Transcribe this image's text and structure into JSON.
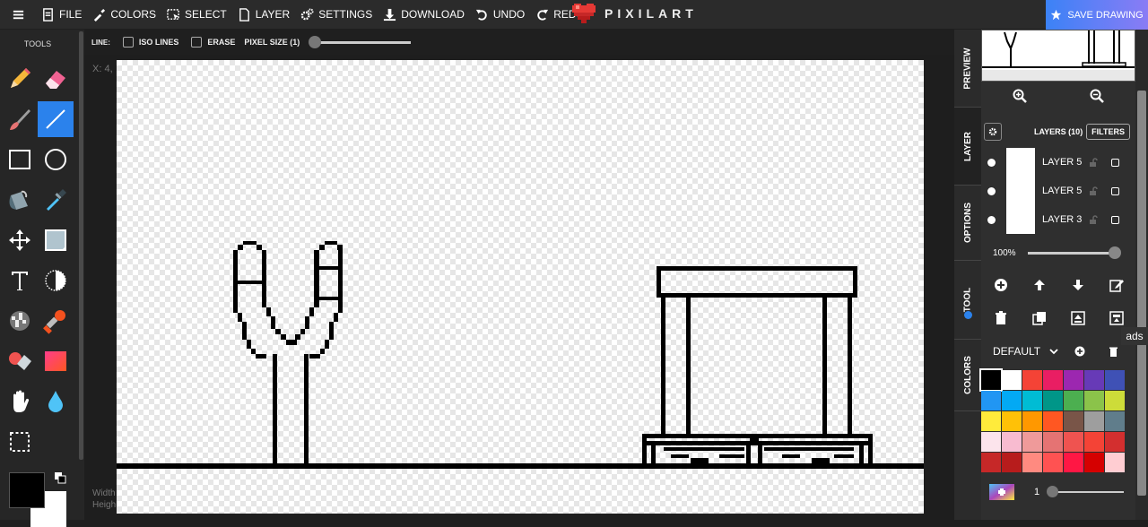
{
  "topbar": {
    "menu": [
      "FILE",
      "COLORS",
      "SELECT",
      "LAYER",
      "SETTINGS",
      "DOWNLOAD",
      "UNDO",
      "REDO"
    ],
    "logo": "PIXILART",
    "save_label": "SAVE DRAWING"
  },
  "tools": {
    "title": "TOOLS",
    "active": "line-tool"
  },
  "options": {
    "line_label": "LINE:",
    "iso_lines": "ISO LINES",
    "erase": "ERASE",
    "pixel_size": "PIXEL SIZE (1)"
  },
  "canvas": {
    "coords": "X: 4,",
    "width_label": "Width",
    "height_label": "Heigh"
  },
  "sidetabs": [
    "PREVIEW",
    "LAYER",
    "OPTIONS",
    "TOOL",
    "COLORS"
  ],
  "layers": {
    "title": "LAYERS (10)",
    "filters": "FILTERS",
    "items": [
      {
        "name": "LAYER 5"
      },
      {
        "name": "LAYER 5"
      },
      {
        "name": "LAYER 3"
      }
    ],
    "opacity": "100%"
  },
  "palette": {
    "name": "DEFAULT",
    "colors": [
      "#000000",
      "#ffffff",
      "#f44336",
      "#e91e63",
      "#9c27b0",
      "#673ab7",
      "#3f51b5",
      "#2196f3",
      "#03a9f4",
      "#00bcd4",
      "#009688",
      "#4caf50",
      "#8bc34a",
      "#cddc39",
      "#ffeb3b",
      "#ffc107",
      "#ff9800",
      "#ff5722",
      "#795548",
      "#9e9e9e",
      "#607d8b",
      "#fce4ec",
      "#f8bbd0",
      "#ef9a9a",
      "#e57373",
      "#ef5350",
      "#f44336",
      "#d32f2f",
      "#c62828",
      "#b71c1c",
      "#ff8a80",
      "#ff5252",
      "#ff1744",
      "#d50000",
      "#ffcdd2"
    ]
  },
  "brush_size": "1",
  "ads": "ads"
}
